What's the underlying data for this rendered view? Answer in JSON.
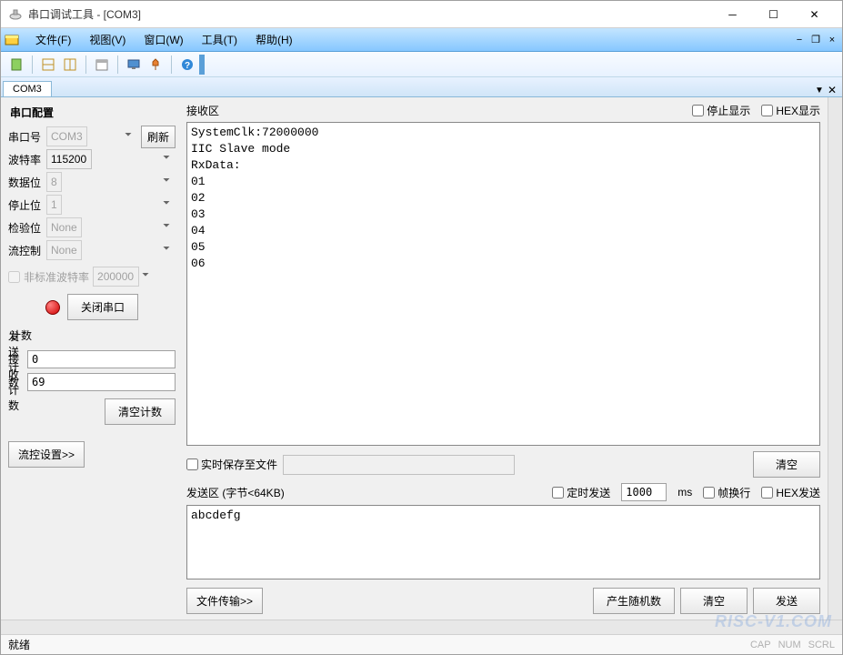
{
  "title": "串口调试工具 - [COM3]",
  "menus": {
    "file": "文件(F)",
    "view": "视图(V)",
    "window": "窗口(W)",
    "tools": "工具(T)",
    "help": "帮助(H)"
  },
  "tab": "COM3",
  "left": {
    "section_title": "串口配置",
    "port_label": "串口号",
    "port_value": "COM3",
    "refresh_label": "刷新",
    "baud_label": "波特率",
    "baud_value": "115200",
    "databits_label": "数据位",
    "databits_value": "8",
    "stopbits_label": "停止位",
    "stopbits_value": "1",
    "parity_label": "检验位",
    "parity_value": "None",
    "flowctrl_label": "流控制",
    "flowctrl_value": "None",
    "custom_baud_label": "非标准波特率",
    "custom_baud_value": "200000",
    "close_port_label": "关闭串口",
    "count_title": "计数",
    "tx_count_label": "发送计数",
    "tx_count_value": "0",
    "rx_count_label": "接收计数",
    "rx_count_value": "69",
    "clear_count_label": "清空计数",
    "flow_settings_label": "流控设置>>"
  },
  "rx": {
    "title": "接收区",
    "stop_display_label": "停止显示",
    "hex_display_label": "HEX显示",
    "content": "SystemClk:72000000\nIIC Slave mode\nRxData:\n01\n02\n03\n04\n05\n06",
    "save_file_label": "实时保存至文件",
    "clear_label": "清空"
  },
  "tx": {
    "title": "发送区 (字节<64KB)",
    "timer_send_label": "定时发送",
    "timer_value": "1000",
    "timer_unit": "ms",
    "framewrap_label": "帧换行",
    "hex_send_label": "HEX发送",
    "content": "abcdefg",
    "file_transfer_label": "文件传输>>",
    "random_label": "产生随机数",
    "clear_label": "清空",
    "send_label": "发送"
  },
  "status": {
    "ready": "就绪",
    "cap": "CAP",
    "num": "NUM",
    "scrl": "SCRL"
  },
  "watermark": "RISC-V1.COM"
}
